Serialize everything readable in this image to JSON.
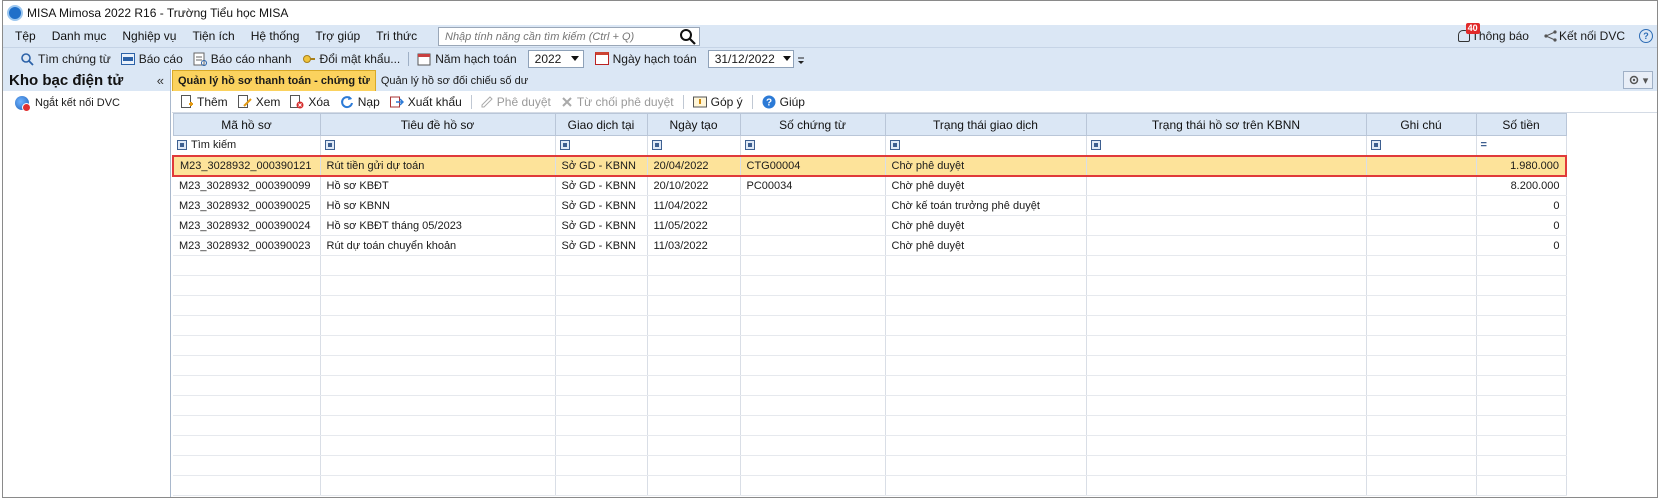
{
  "window": {
    "title": "MISA Mimosa 2022 R16 - Trường Tiểu học MISA"
  },
  "menu": {
    "items": [
      "Tệp",
      "Danh mục",
      "Nghiệp vụ",
      "Tiện ích",
      "Hệ thống",
      "Trợ giúp",
      "Tri thức"
    ],
    "search_placeholder": "Nhập tính năng cần tìm kiếm (Ctrl + Q)",
    "notifications_label": "Thông báo",
    "notifications_count": "40",
    "dvc_label": "Kết nối DVC"
  },
  "toolbar": {
    "find_voucher": "Tìm chứng từ",
    "report": "Báo cáo",
    "quick_report": "Báo cáo nhanh",
    "change_password": "Đổi mật khẩu...",
    "fiscal_year_label": "Năm hạch toán",
    "fiscal_year_value": "2022",
    "posting_date_label": "Ngày hạch toán",
    "posting_date_value": "31/12/2022"
  },
  "left_panel": {
    "title": "Kho bạc điện tử",
    "collapse_symbol": "«",
    "items": [
      {
        "label": "Ngắt kết nối DVC"
      }
    ]
  },
  "tabs": [
    {
      "label": "Quản lý hồ sơ thanh toán - chứng từ",
      "active": true
    },
    {
      "label": "Quản lý hồ sơ đối chiếu số dư",
      "active": false
    }
  ],
  "actions": {
    "add": "Thêm",
    "view": "Xem",
    "delete": "Xóa",
    "reload": "Nạp",
    "export": "Xuất khẩu",
    "approve": "Phê duyệt",
    "reject": "Từ chối phê duyệt",
    "feedback": "Góp ý",
    "help": "Giúp"
  },
  "grid": {
    "columns": [
      "Mã hồ sơ",
      "Tiêu đề hồ sơ",
      "Giao dịch tại",
      "Ngày tạo",
      "Số chứng từ",
      "Trạng thái giao dịch",
      "Trạng thái hồ sơ trên KBNN",
      "Ghi chú",
      "Số tiền"
    ],
    "filter_placeholder": "Tìm kiếm",
    "filter_eq": "=",
    "rows": [
      {
        "code": "M23_3028932_000390121",
        "title": "Rút tiền gửi dự toán",
        "place": "Sở GD - KBNN",
        "date": "20/04/2022",
        "voucher": "CTG00004",
        "status": "Chờ phê duyệt",
        "kbnn_status": "",
        "note": "",
        "amount": "1.980.000"
      },
      {
        "code": "M23_3028932_000390099",
        "title": "Hồ sơ KBĐT",
        "place": "Sở GD - KBNN",
        "date": "20/10/2022",
        "voucher": "PC00034",
        "status": "Chờ phê duyệt",
        "kbnn_status": "",
        "note": "",
        "amount": "8.200.000"
      },
      {
        "code": "M23_3028932_000390025",
        "title": "Hồ sơ KBNN",
        "place": "Sở GD - KBNN",
        "date": "11/04/2022",
        "voucher": "",
        "status": "Chờ kế toán trưởng phê duyệt",
        "kbnn_status": "",
        "note": "",
        "amount": "0"
      },
      {
        "code": "M23_3028932_000390024",
        "title": "Hồ sơ KBĐT tháng 05/2023",
        "place": "Sở GD - KBNN",
        "date": "11/05/2022",
        "voucher": "",
        "status": "Chờ phê duyệt",
        "kbnn_status": "",
        "note": "",
        "amount": "0"
      },
      {
        "code": "M23_3028932_000390023",
        "title": "Rút dự toán chuyển khoản",
        "place": "Sở GD - KBNN",
        "date": "11/03/2022",
        "voucher": "",
        "status": "Chờ phê duyệt",
        "kbnn_status": "",
        "note": "",
        "amount": "0"
      }
    ]
  }
}
